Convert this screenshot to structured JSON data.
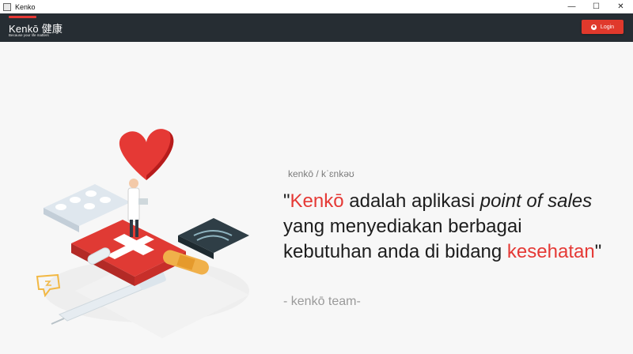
{
  "window": {
    "title": "Kenko",
    "controls": {
      "minimize": "—",
      "maximize": "☐",
      "close": "✕"
    }
  },
  "header": {
    "brand_title": "Kenkō 健康",
    "brand_tagline": "Because your life matters",
    "login_label": "Login",
    "accent_color": "#e53935",
    "bar_color": "#262d33"
  },
  "hero": {
    "phonetic": "kenkō / kˈɛnkəʊ",
    "quote": {
      "open": "\"",
      "brand": "Kenkō",
      "p1": " adalah aplikasi ",
      "p2": "point of sales",
      "p3": " yang menyediakan berbagai kebutuhan anda di bidang ",
      "p4": "kesehatan",
      "close": "\""
    },
    "author": "- kenkō team-"
  },
  "icons": {
    "login": "user-circle-icon",
    "illustration": "medical-isometric-illustration"
  }
}
